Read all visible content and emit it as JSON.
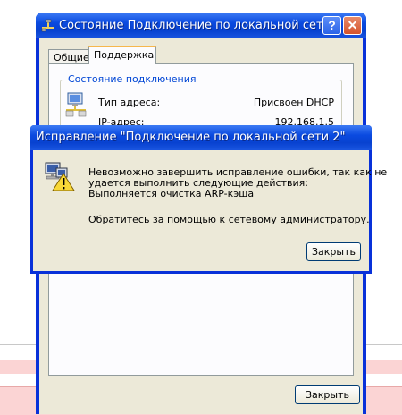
{
  "main_window": {
    "title": "Состояние Подключение по локальной сет...",
    "help_button": "?",
    "close_button": "✕",
    "tabs": [
      {
        "label": "Общие"
      },
      {
        "label": "Поддержка"
      }
    ],
    "group_label": "Состояние подключения",
    "address_type_label": "Тип адреса:",
    "address_type_value": "Присвоен DHCP",
    "ip_label": "IP-адрес:",
    "ip_value": "192.168.1.5",
    "close_label": "Закрыть"
  },
  "repair_dialog": {
    "title": "Исправление \"Подключение по локальной сети 2\"",
    "message_lines": [
      "Невозможно завершить исправление ошибки, так как не",
      "удается выполнить следующие действия:",
      "Выполняется очистка ARP-кэша"
    ],
    "contact": "Обратитесь за помощью к сетевому администратору.",
    "close_label": "Закрыть"
  },
  "icons": {
    "title_icon": "network-connection-icon",
    "connection_icon": "network-computers-icon",
    "warning_icon": "network-warning-icon"
  }
}
